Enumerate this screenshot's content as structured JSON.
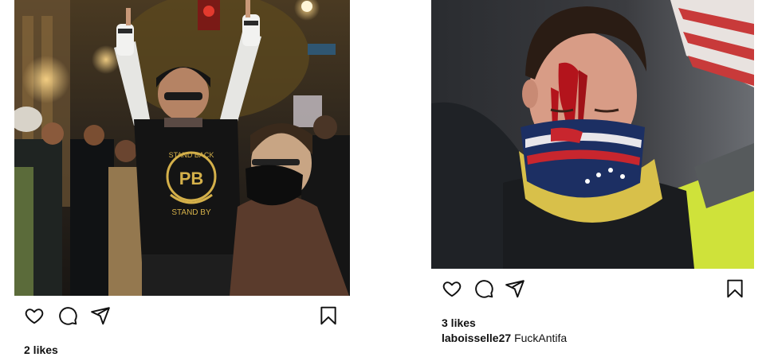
{
  "posts": [
    {
      "likes_text": "2 likes",
      "image_desc": "protester-raising-hands",
      "shirt_text": [
        "STAND BACK",
        "PB",
        "STAND BY"
      ],
      "icons": [
        "heart-icon",
        "comment-icon",
        "share-icon",
        "bookmark-icon"
      ]
    },
    {
      "likes_text": "3 likes",
      "caption_user": "laboisselle27",
      "caption_text": "FuckAntifa",
      "image_desc": "injured-man-flag-bandana",
      "icons": [
        "heart-icon",
        "comment-icon",
        "share-icon",
        "bookmark-icon"
      ]
    }
  ],
  "colors": {
    "icon_stroke": "#111111",
    "background": "#ffffff",
    "blood": "#b3141c"
  }
}
